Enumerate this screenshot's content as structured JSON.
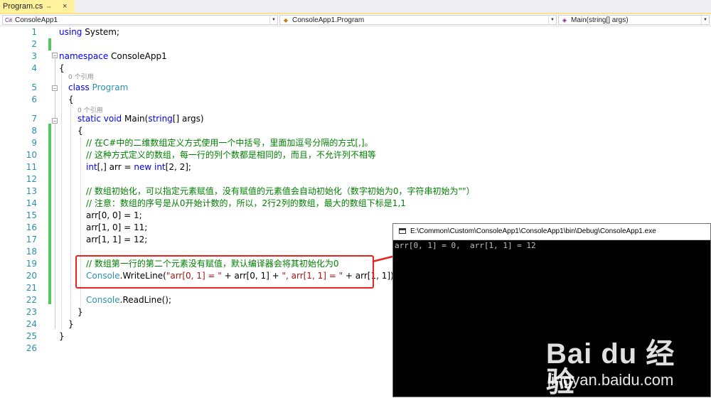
{
  "tab": {
    "label": "Program.cs",
    "pin": "⇔",
    "close": "×"
  },
  "nav": {
    "project": "ConsoleApp1",
    "project_icon": "C#",
    "class": "ConsoleApp1.Program",
    "member": "Main(string[] args)"
  },
  "lines": [
    {
      "n": "1",
      "kind": "simple",
      "parts": [
        {
          "t": "using",
          "c": "kw"
        },
        {
          "t": " System;",
          "c": ""
        }
      ]
    },
    {
      "n": "2"
    },
    {
      "n": "3",
      "parts": [
        {
          "t": "namespace",
          "c": "kw"
        },
        {
          "t": " ConsoleApp1",
          "c": ""
        }
      ]
    },
    {
      "n": "4",
      "parts": [
        {
          "t": "{",
          "c": ""
        }
      ]
    },
    {
      "n": "5",
      "parts": [
        {
          "t": "class",
          "c": "kw"
        },
        {
          "t": " ",
          "c": ""
        },
        {
          "t": "Program",
          "c": "ty"
        }
      ]
    },
    {
      "n": "6",
      "parts": [
        {
          "t": "{",
          "c": ""
        }
      ]
    },
    {
      "n": "7",
      "parts": [
        {
          "t": "static",
          "c": "kw"
        },
        {
          "t": " ",
          "c": ""
        },
        {
          "t": "void",
          "c": "kw"
        },
        {
          "t": " Main(",
          "c": ""
        },
        {
          "t": "string",
          "c": "kw"
        },
        {
          "t": "[] args)",
          "c": ""
        }
      ]
    },
    {
      "n": "8",
      "parts": [
        {
          "t": "{",
          "c": ""
        }
      ]
    },
    {
      "n": "9",
      "parts": [
        {
          "t": "// 在C#中的二维数组定义方式使用一个中括号，里面加逗号分隔的方式[,]。",
          "c": "cm"
        }
      ]
    },
    {
      "n": "10",
      "parts": [
        {
          "t": "// 这种方式定义的数组，每一行的列个数都是相同的，而且，不允许列不相等",
          "c": "cm"
        }
      ]
    },
    {
      "n": "11",
      "parts": [
        {
          "t": "int",
          "c": "kw"
        },
        {
          "t": "[,] arr = ",
          "c": ""
        },
        {
          "t": "new",
          "c": "kw"
        },
        {
          "t": " ",
          "c": ""
        },
        {
          "t": "int",
          "c": "kw"
        },
        {
          "t": "[2, 2];",
          "c": ""
        }
      ]
    },
    {
      "n": "12"
    },
    {
      "n": "13",
      "parts": [
        {
          "t": "// 数组初始化，可以指定元素赋值，没有赋值的元素值会自动初始化（数字初始为0，字符串初始为\"\"）",
          "c": "cm"
        }
      ]
    },
    {
      "n": "14",
      "parts": [
        {
          "t": "// 注意：数组的序号是从0开始计数的，所以，2行2列的数组，最大的数组下标是1,1",
          "c": "cm"
        }
      ]
    },
    {
      "n": "15",
      "parts": [
        {
          "t": "arr[0, 0] = 1;",
          "c": ""
        }
      ]
    },
    {
      "n": "16",
      "parts": [
        {
          "t": "arr[1, 0] = 11;",
          "c": ""
        }
      ]
    },
    {
      "n": "17",
      "parts": [
        {
          "t": "arr[1, 1] = 12;",
          "c": ""
        }
      ]
    },
    {
      "n": "18"
    },
    {
      "n": "19",
      "parts": [
        {
          "t": "// 数组第一行的第二个元素没有赋值，默认编译器会将其初始化为0",
          "c": "cm"
        }
      ]
    },
    {
      "n": "20",
      "parts": [
        {
          "t": "Console",
          "c": "ty"
        },
        {
          "t": ".WriteLine(",
          "c": ""
        },
        {
          "t": "\"arr[0, 1] = \"",
          "c": "str"
        },
        {
          "t": " + arr[0, 1] + ",
          "c": ""
        },
        {
          "t": "\", arr[1, 1] = \"",
          "c": "str"
        },
        {
          "t": " + arr[1, 1]);",
          "c": ""
        }
      ]
    },
    {
      "n": "21"
    },
    {
      "n": "22",
      "parts": [
        {
          "t": "Console",
          "c": "ty"
        },
        {
          "t": ".ReadLine();",
          "c": ""
        }
      ]
    },
    {
      "n": "23",
      "parts": [
        {
          "t": "}",
          "c": ""
        }
      ]
    },
    {
      "n": "24",
      "parts": [
        {
          "t": "}",
          "c": ""
        }
      ]
    },
    {
      "n": "25",
      "parts": [
        {
          "t": "}",
          "c": ""
        }
      ]
    },
    {
      "n": "26"
    }
  ],
  "codelens": {
    "refs": "0 个引用"
  },
  "console": {
    "title": "E:\\Common\\Custom\\ConsoleApp1\\ConsoleApp1\\bin\\Debug\\ConsoleApp1.exe",
    "output": "arr[0, 1] = 0,  arr[1, 1] = 12"
  },
  "watermark": {
    "brand": "Bai du 经验",
    "url": "jingyan.baidu.com"
  },
  "colors": {
    "keyword": "#0000ff",
    "type": "#2b91af",
    "comment": "#008000",
    "string": "#a31515",
    "linenum": "#2b91af",
    "change": "#57c45c",
    "highlight": "#e8241e"
  }
}
